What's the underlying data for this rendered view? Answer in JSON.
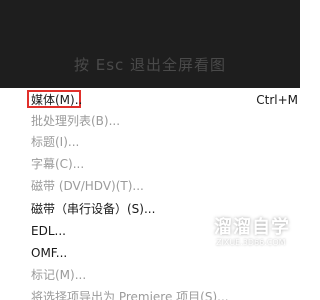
{
  "overlay": {
    "esc_hint": "按 Esc 退出全屏看图"
  },
  "menu": {
    "items": [
      {
        "label": "媒体(M)..",
        "shortcut": "Ctrl+M",
        "enabled": true,
        "highlighted": true
      },
      {
        "label": "批处理列表(B)...",
        "enabled": false
      },
      {
        "label": "标题(I)...",
        "enabled": false
      },
      {
        "label": "字幕(C)...",
        "enabled": false
      },
      {
        "label": "磁带 (DV/HDV)(T)...",
        "enabled": false
      },
      {
        "label": "磁带（串行设备）(S)...",
        "enabled": true
      },
      {
        "label": "EDL...",
        "enabled": true
      },
      {
        "label": "OMF...",
        "enabled": true
      },
      {
        "label": "标记(M)...",
        "enabled": false
      },
      {
        "label": "将选择项导出为 Premiere 项目(S)...",
        "enabled": false
      }
    ]
  },
  "watermark": {
    "title": "溜溜自学",
    "url": "ZIXUE.3D66.COM",
    "icon": "play-logo-icon"
  },
  "colors": {
    "highlight_border": "#e0302b",
    "dark_bar": "#1e1e1e",
    "disabled_text": "#9b9b9b"
  }
}
